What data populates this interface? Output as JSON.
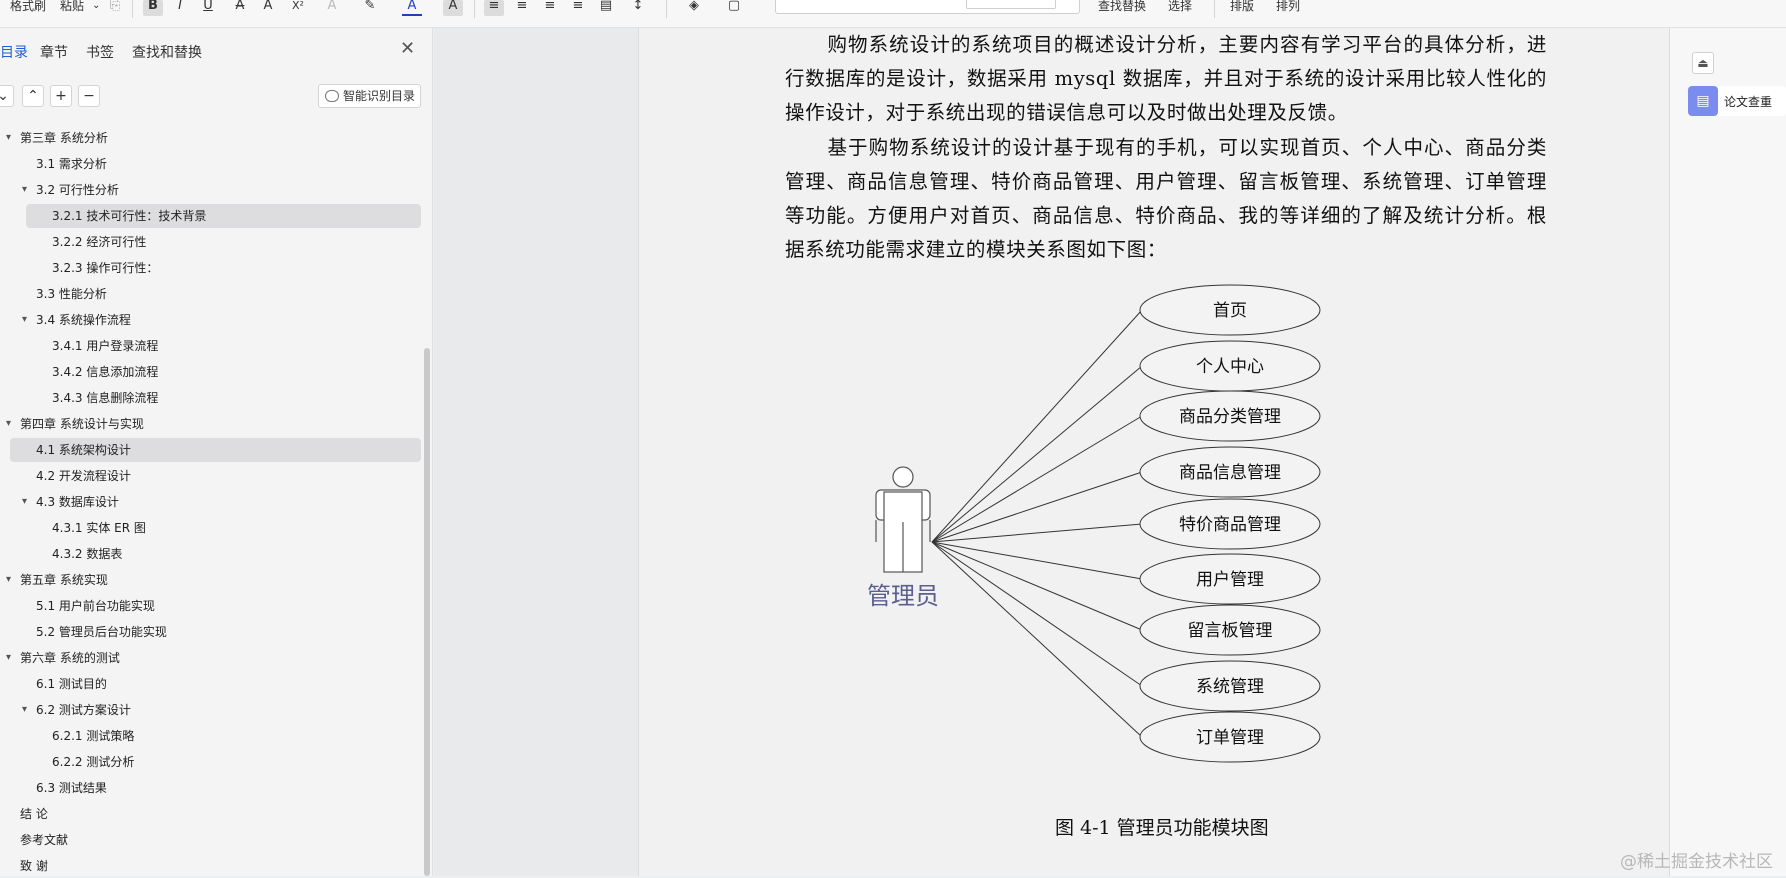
{
  "toolbar": {
    "format_brush": "格式刷",
    "paste": "粘贴",
    "find_replace": "查找替换",
    "select": "选择",
    "typesetting": "排版",
    "arrange": "排列"
  },
  "sidebar": {
    "tabs": [
      "目录",
      "章节",
      "书签",
      "查找和替换"
    ],
    "active_tab": 0,
    "smart_toc_label": "智能识别目录",
    "toc": [
      {
        "label": "第三章  系统分析",
        "level": 0,
        "expanded": true
      },
      {
        "label": "3.1 需求分析",
        "level": 1
      },
      {
        "label": "3.2 可行性分析",
        "level": 1,
        "expanded": true
      },
      {
        "label": "3.2.1 技术可行性：技术背景",
        "level": 2,
        "selected": true
      },
      {
        "label": "3.2.2 经济可行性",
        "level": 2
      },
      {
        "label": "3.2.3 操作可行性：",
        "level": 2
      },
      {
        "label": "3.3 性能分析",
        "level": 1
      },
      {
        "label": "3.4 系统操作流程",
        "level": 1,
        "expanded": true
      },
      {
        "label": "3.4.1 用户登录流程",
        "level": 2
      },
      {
        "label": "3.4.2 信息添加流程",
        "level": 2
      },
      {
        "label": "3.4.3 信息删除流程",
        "level": 2
      },
      {
        "label": "第四章  系统设计与实现",
        "level": 0,
        "expanded": true
      },
      {
        "label": "4.1 系统架构设计",
        "level": 1,
        "selected": true
      },
      {
        "label": "4.2 开发流程设计",
        "level": 1
      },
      {
        "label": "4.3 数据库设计",
        "level": 1,
        "expanded": true
      },
      {
        "label": "4.3.1 实体 ER 图",
        "level": 2
      },
      {
        "label": "4.3.2 数据表",
        "level": 2
      },
      {
        "label": "第五章  系统实现",
        "level": 0,
        "expanded": true
      },
      {
        "label": "5.1 用户前台功能实现",
        "level": 1
      },
      {
        "label": "5.2  管理员后台功能实现",
        "level": 1
      },
      {
        "label": "第六章    系统的测试",
        "level": 0,
        "expanded": true
      },
      {
        "label": "6.1  测试目的",
        "level": 1
      },
      {
        "label": "6.2  测试方案设计",
        "level": 1,
        "expanded": true
      },
      {
        "label": "6.2.1  测试策略",
        "level": 2
      },
      {
        "label": "6.2.2  测试分析",
        "level": 2
      },
      {
        "label": "6.3  测试结果",
        "level": 1
      },
      {
        "label": "结    论",
        "level": 0
      },
      {
        "label": "参考文献",
        "level": 0
      },
      {
        "label": "致    谢",
        "level": 0
      }
    ]
  },
  "document": {
    "para1": "购物系统设计的系统项目的概述设计分析，主要内容有学习平台的具体分析，进行数据库的是设计，数据采用 mysql 数据库，并且对于系统的设计采用比较人性化的操作设计，对于系统出现的错误信息可以及时做出处理及反馈。",
    "para2": "基于购物系统设计的设计基于现有的手机，可以实现首页、个人中心、商品分类管理、商品信息管理、特价商品管理、用户管理、留言板管理、系统管理、订单管理等功能。方便用户对首页、商品信息、特价商品、我的等详细的了解及统计分析。根据系统功能需求建立的模块关系图如下图：",
    "actor_label": "管理员",
    "modules": [
      "首页",
      "个人中心",
      "商品分类管理",
      "商品信息管理",
      "特价商品管理",
      "用户管理",
      "留言板管理",
      "系统管理",
      "订单管理"
    ],
    "caption": "图 4-1 管理员功能模块图"
  },
  "right_panel": {
    "paper_check": "论文查重"
  },
  "watermark": "@稀土掘金技术社区",
  "colors": {
    "accent": "#1f5fd1",
    "actor": "#5a5f8f",
    "paper_check_icon": "#7b8cf0"
  }
}
